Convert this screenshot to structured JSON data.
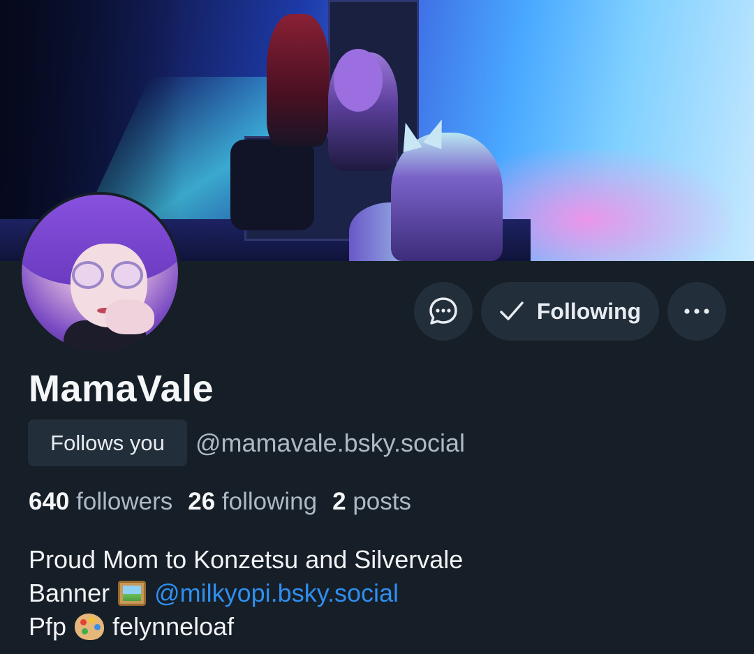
{
  "profile": {
    "display_name": "MamaVale",
    "follows_you_label": "Follows you",
    "handle": "@mamavale.bsky.social"
  },
  "actions": {
    "message_icon": "message-bubble-icon",
    "following_label": "Following",
    "following_icon": "check-icon",
    "more_icon": "ellipsis-icon"
  },
  "stats": {
    "followers_count": "640",
    "followers_label": "followers",
    "following_count": "26",
    "following_label": "following",
    "posts_count": "2",
    "posts_label": "posts"
  },
  "bio": {
    "line1": "Proud Mom to Konzetsu and Silvervale",
    "line2_prefix": "Banner",
    "line2_emoji": "framed-picture-icon",
    "line2_mention": "@milkyopi.bsky.social",
    "line3_prefix": "Pfp",
    "line3_emoji": "artist-palette-icon",
    "line3_credit": "felynneloaf"
  },
  "colors": {
    "background": "#161e27",
    "button_bg": "#222e3a",
    "muted_text": "#aeb9c5",
    "link": "#2f8ff0"
  }
}
